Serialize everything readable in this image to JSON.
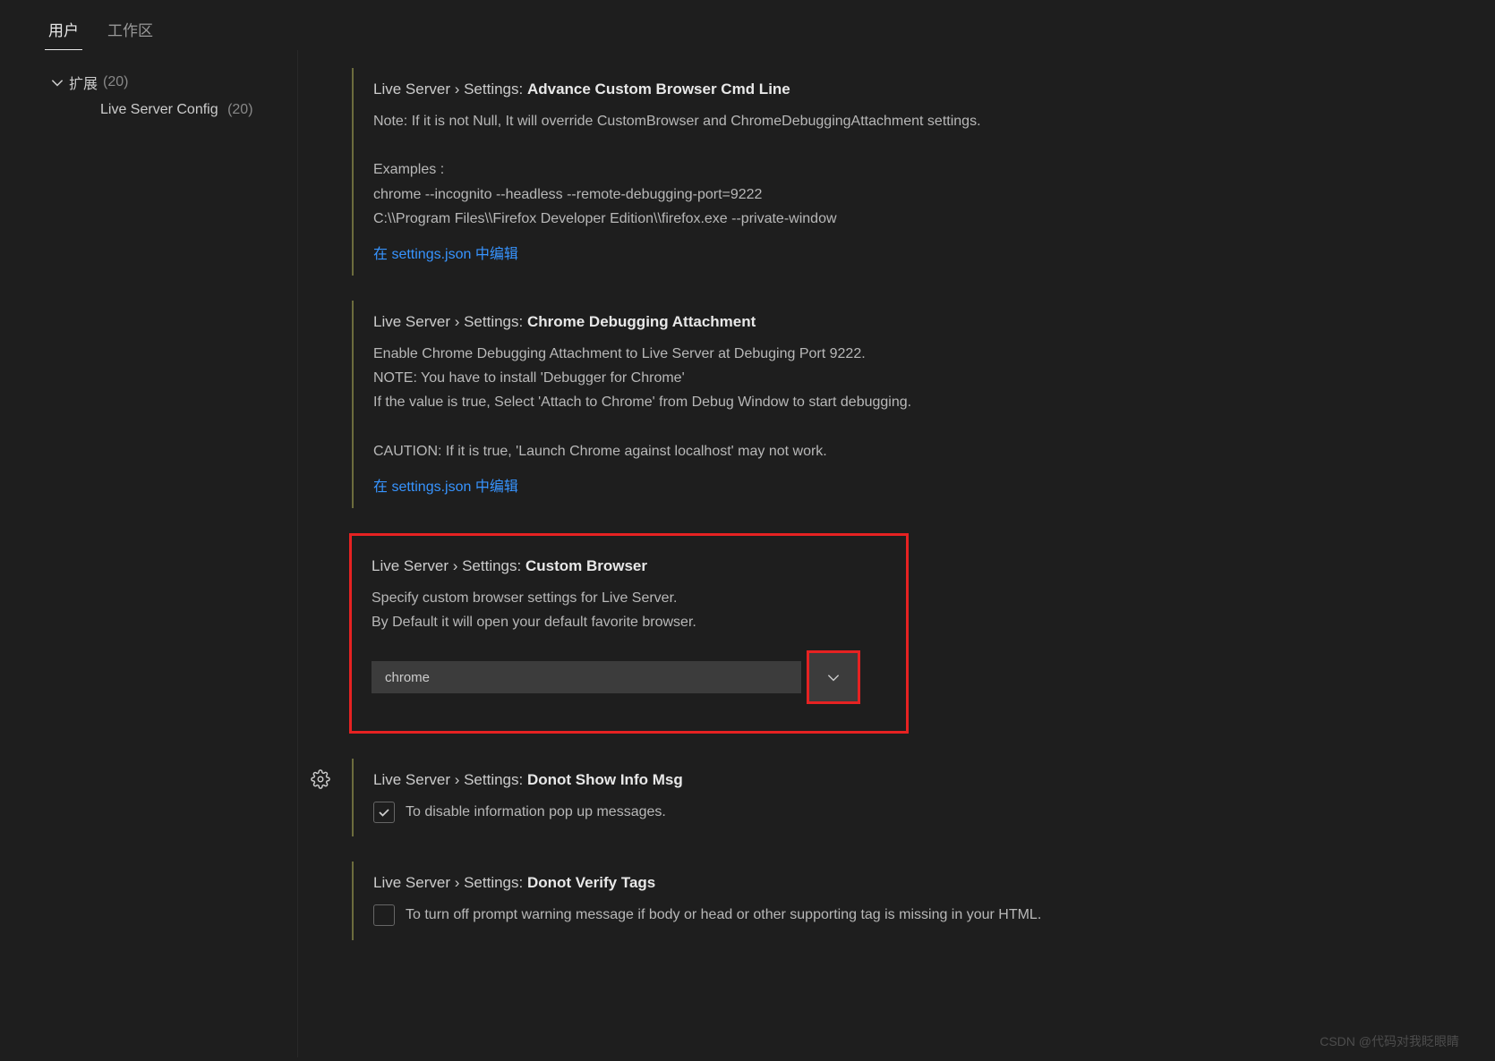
{
  "tabs": {
    "user": "用户",
    "workspace": "工作区"
  },
  "sidebar": {
    "extensions_label": "扩展",
    "extensions_count": "(20)",
    "live_server_label": "Live Server Config",
    "live_server_count": "(20)"
  },
  "settings": {
    "advance_cmd": {
      "prefix": "Live Server › Settings: ",
      "title": "Advance Custom Browser Cmd Line",
      "desc_line1": "Note: If it is not Null, It will override CustomBrowser and ChromeDebuggingAttachment settings.",
      "desc_line2": "Examples :",
      "desc_line3": "chrome --incognito --headless --remote-debugging-port=9222",
      "desc_line4": "C:\\\\Program Files\\\\Firefox Developer Edition\\\\firefox.exe --private-window",
      "edit_link": "在 settings.json 中编辑"
    },
    "chrome_debug": {
      "prefix": "Live Server › Settings: ",
      "title": "Chrome Debugging Attachment",
      "desc_line1": "Enable Chrome Debugging Attachment to Live Server at Debuging Port 9222.",
      "desc_line2": "NOTE: You have to install 'Debugger for Chrome'",
      "desc_line3": "If the value is true, Select 'Attach to Chrome' from Debug Window to start debugging.",
      "desc_line4": "CAUTION: If it is true, 'Launch Chrome against localhost' may not work.",
      "edit_link": "在 settings.json 中编辑"
    },
    "custom_browser": {
      "prefix": "Live Server › Settings: ",
      "title": "Custom Browser",
      "desc_line1": "Specify custom browser settings for Live Server.",
      "desc_line2": "By Default it will open your default favorite browser.",
      "value": "chrome"
    },
    "donot_show_info": {
      "prefix": "Live Server › Settings: ",
      "title": "Donot Show Info Msg",
      "desc": "To disable information pop up messages."
    },
    "donot_verify_tags": {
      "prefix": "Live Server › Settings: ",
      "title": "Donot Verify Tags",
      "desc": "To turn off prompt warning message if body or head or other supporting tag is missing in your HTML."
    }
  },
  "watermark": "CSDN @代码对我眨眼睛"
}
